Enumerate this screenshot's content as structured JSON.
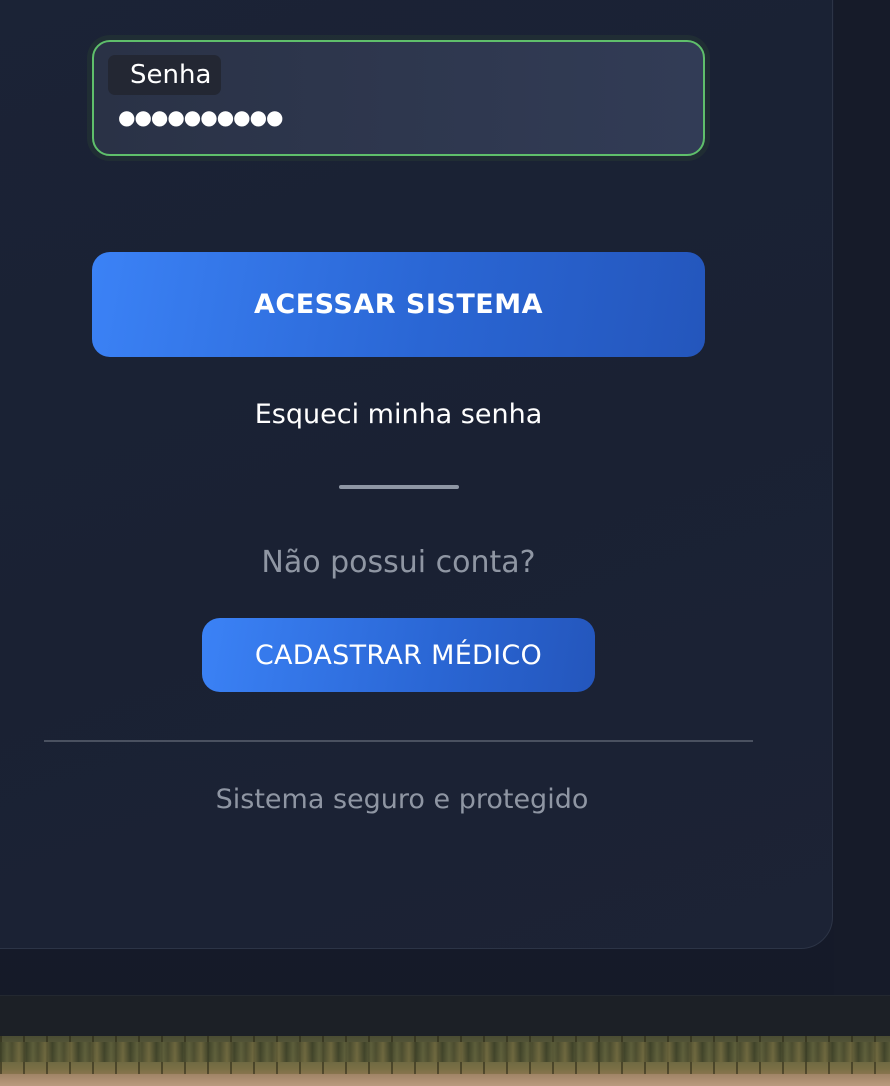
{
  "login_form": {
    "password_field": {
      "label": "Senha",
      "value": "●●●●●●●●●●"
    },
    "submit_label": "ACESSAR SISTEMA",
    "forgot_password_label": "Esqueci minha senha",
    "no_account_text": "Não possui conta?",
    "register_label": "CADASTRAR MÉDICO",
    "security_note": "Sistema seguro e protegido"
  },
  "colors": {
    "accent": "#3b82f6",
    "field_focus_border": "#5fbf6b",
    "card_background": "#1b2336",
    "muted_text": "#8f96a3"
  }
}
